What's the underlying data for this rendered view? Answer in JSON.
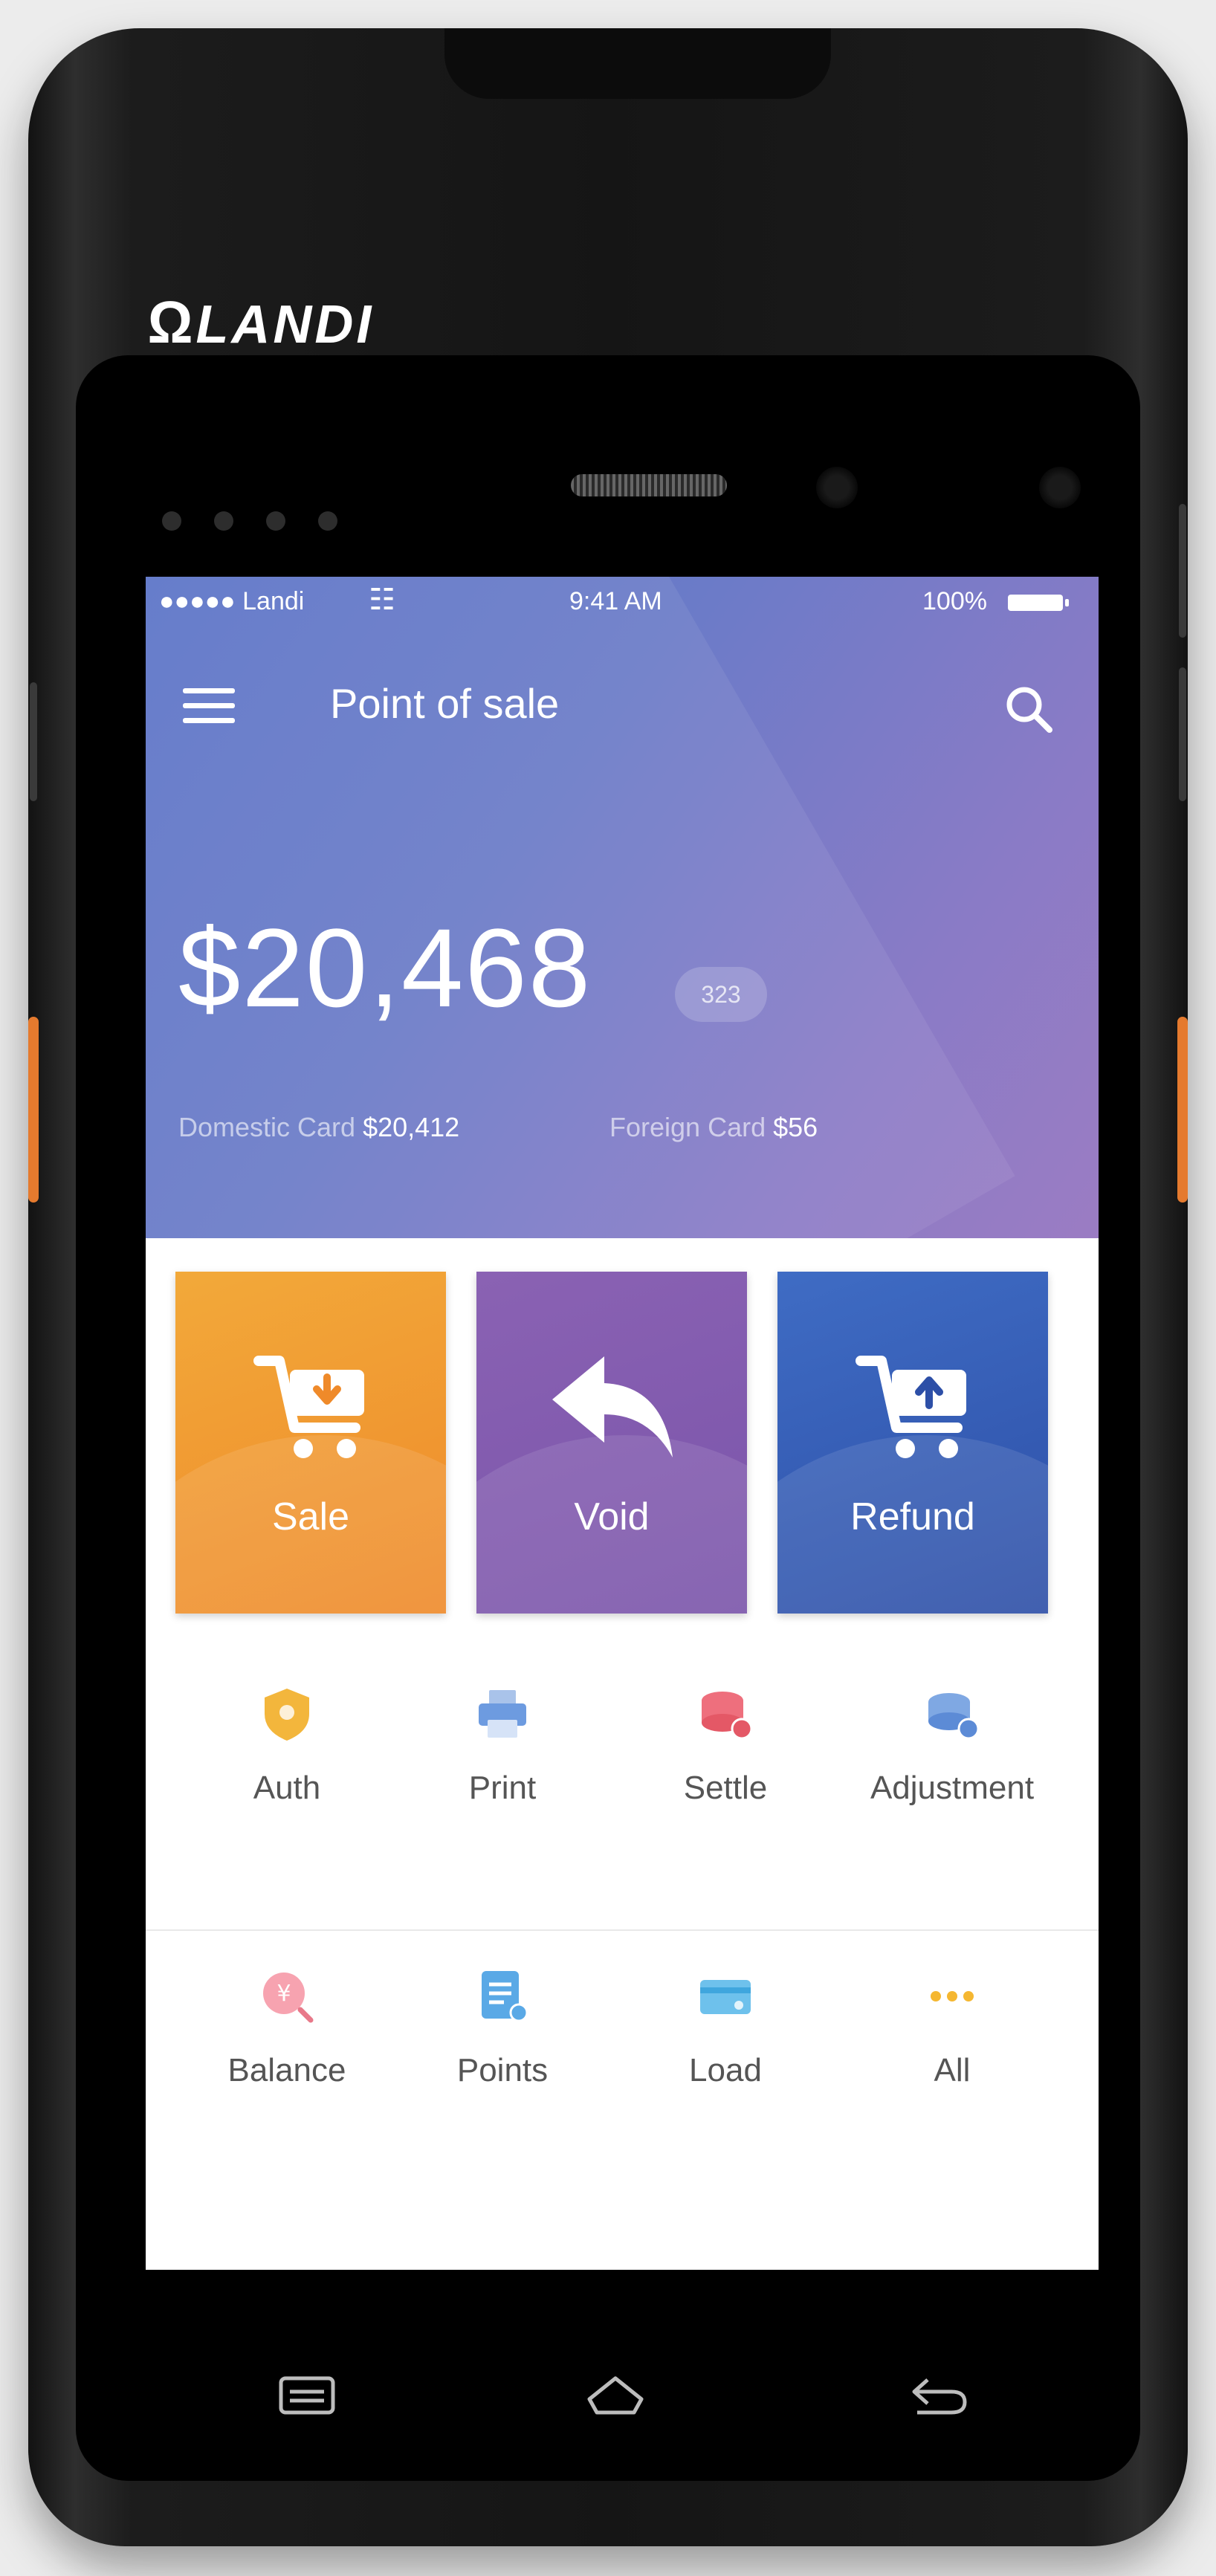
{
  "device": {
    "brand": "LANDI"
  },
  "status_bar": {
    "carrier": "●●●●● Landi",
    "time": "9:41 AM",
    "battery": "100%"
  },
  "header": {
    "title": "Point of sale",
    "balance": "$20,468",
    "transaction_count": "323",
    "domestic_label": "Domestic Card",
    "domestic_value": "$20,412",
    "foreign_label": "Foreign Card",
    "foreign_value": "$56"
  },
  "actions": {
    "sale": "Sale",
    "void": "Void",
    "refund": "Refund"
  },
  "functions": {
    "auth": "Auth",
    "print": "Print",
    "settle": "Settle",
    "adjustment": "Adjustment",
    "balance": "Balance",
    "points": "Points",
    "load": "Load",
    "all": "All"
  },
  "colors": {
    "header_start": "#5b74c8",
    "header_end": "#9b7cc3",
    "sale": "#ef8a2a",
    "void": "#7a54aa",
    "refund": "#2d4fa7",
    "accent_orange": "#e57a2e"
  },
  "icons": {
    "menu": "menu-icon",
    "search": "search-icon",
    "sale": "cart-download-icon",
    "void": "undo-arrow-icon",
    "refund": "cart-upload-icon",
    "auth": "shield-icon",
    "print": "printer-icon",
    "settle": "coins-check-icon",
    "adjustment": "coins-edit-icon",
    "balance": "yen-search-icon",
    "points": "list-document-icon",
    "load": "card-icon",
    "all": "more-dots-icon"
  }
}
